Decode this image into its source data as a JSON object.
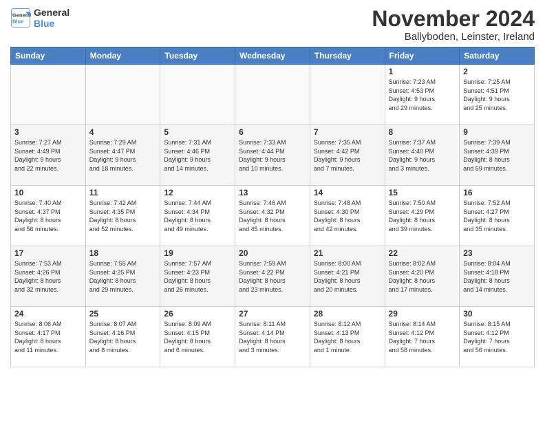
{
  "logo": {
    "line1": "General",
    "line2": "Blue"
  },
  "title": "November 2024",
  "subtitle": "Ballyboden, Leinster, Ireland",
  "weekdays": [
    "Sunday",
    "Monday",
    "Tuesday",
    "Wednesday",
    "Thursday",
    "Friday",
    "Saturday"
  ],
  "weeks": [
    [
      {
        "day": "",
        "info": ""
      },
      {
        "day": "",
        "info": ""
      },
      {
        "day": "",
        "info": ""
      },
      {
        "day": "",
        "info": ""
      },
      {
        "day": "",
        "info": ""
      },
      {
        "day": "1",
        "info": "Sunrise: 7:23 AM\nSunset: 4:53 PM\nDaylight: 9 hours\nand 29 minutes."
      },
      {
        "day": "2",
        "info": "Sunrise: 7:25 AM\nSunset: 4:51 PM\nDaylight: 9 hours\nand 25 minutes."
      }
    ],
    [
      {
        "day": "3",
        "info": "Sunrise: 7:27 AM\nSunset: 4:49 PM\nDaylight: 9 hours\nand 22 minutes."
      },
      {
        "day": "4",
        "info": "Sunrise: 7:29 AM\nSunset: 4:47 PM\nDaylight: 9 hours\nand 18 minutes."
      },
      {
        "day": "5",
        "info": "Sunrise: 7:31 AM\nSunset: 4:46 PM\nDaylight: 9 hours\nand 14 minutes."
      },
      {
        "day": "6",
        "info": "Sunrise: 7:33 AM\nSunset: 4:44 PM\nDaylight: 9 hours\nand 10 minutes."
      },
      {
        "day": "7",
        "info": "Sunrise: 7:35 AM\nSunset: 4:42 PM\nDaylight: 9 hours\nand 7 minutes."
      },
      {
        "day": "8",
        "info": "Sunrise: 7:37 AM\nSunset: 4:40 PM\nDaylight: 9 hours\nand 3 minutes."
      },
      {
        "day": "9",
        "info": "Sunrise: 7:39 AM\nSunset: 4:39 PM\nDaylight: 8 hours\nand 59 minutes."
      }
    ],
    [
      {
        "day": "10",
        "info": "Sunrise: 7:40 AM\nSunset: 4:37 PM\nDaylight: 8 hours\nand 56 minutes."
      },
      {
        "day": "11",
        "info": "Sunrise: 7:42 AM\nSunset: 4:35 PM\nDaylight: 8 hours\nand 52 minutes."
      },
      {
        "day": "12",
        "info": "Sunrise: 7:44 AM\nSunset: 4:34 PM\nDaylight: 8 hours\nand 49 minutes."
      },
      {
        "day": "13",
        "info": "Sunrise: 7:46 AM\nSunset: 4:32 PM\nDaylight: 8 hours\nand 45 minutes."
      },
      {
        "day": "14",
        "info": "Sunrise: 7:48 AM\nSunset: 4:30 PM\nDaylight: 8 hours\nand 42 minutes."
      },
      {
        "day": "15",
        "info": "Sunrise: 7:50 AM\nSunset: 4:29 PM\nDaylight: 8 hours\nand 39 minutes."
      },
      {
        "day": "16",
        "info": "Sunrise: 7:52 AM\nSunset: 4:27 PM\nDaylight: 8 hours\nand 35 minutes."
      }
    ],
    [
      {
        "day": "17",
        "info": "Sunrise: 7:53 AM\nSunset: 4:26 PM\nDaylight: 8 hours\nand 32 minutes."
      },
      {
        "day": "18",
        "info": "Sunrise: 7:55 AM\nSunset: 4:25 PM\nDaylight: 8 hours\nand 29 minutes."
      },
      {
        "day": "19",
        "info": "Sunrise: 7:57 AM\nSunset: 4:23 PM\nDaylight: 8 hours\nand 26 minutes."
      },
      {
        "day": "20",
        "info": "Sunrise: 7:59 AM\nSunset: 4:22 PM\nDaylight: 8 hours\nand 23 minutes."
      },
      {
        "day": "21",
        "info": "Sunrise: 8:00 AM\nSunset: 4:21 PM\nDaylight: 8 hours\nand 20 minutes."
      },
      {
        "day": "22",
        "info": "Sunrise: 8:02 AM\nSunset: 4:20 PM\nDaylight: 8 hours\nand 17 minutes."
      },
      {
        "day": "23",
        "info": "Sunrise: 8:04 AM\nSunset: 4:18 PM\nDaylight: 8 hours\nand 14 minutes."
      }
    ],
    [
      {
        "day": "24",
        "info": "Sunrise: 8:06 AM\nSunset: 4:17 PM\nDaylight: 8 hours\nand 11 minutes."
      },
      {
        "day": "25",
        "info": "Sunrise: 8:07 AM\nSunset: 4:16 PM\nDaylight: 8 hours\nand 8 minutes."
      },
      {
        "day": "26",
        "info": "Sunrise: 8:09 AM\nSunset: 4:15 PM\nDaylight: 8 hours\nand 6 minutes."
      },
      {
        "day": "27",
        "info": "Sunrise: 8:11 AM\nSunset: 4:14 PM\nDaylight: 8 hours\nand 3 minutes."
      },
      {
        "day": "28",
        "info": "Sunrise: 8:12 AM\nSunset: 4:13 PM\nDaylight: 8 hours\nand 1 minute."
      },
      {
        "day": "29",
        "info": "Sunrise: 8:14 AM\nSunset: 4:12 PM\nDaylight: 7 hours\nand 58 minutes."
      },
      {
        "day": "30",
        "info": "Sunrise: 8:15 AM\nSunset: 4:12 PM\nDaylight: 7 hours\nand 56 minutes."
      }
    ]
  ]
}
